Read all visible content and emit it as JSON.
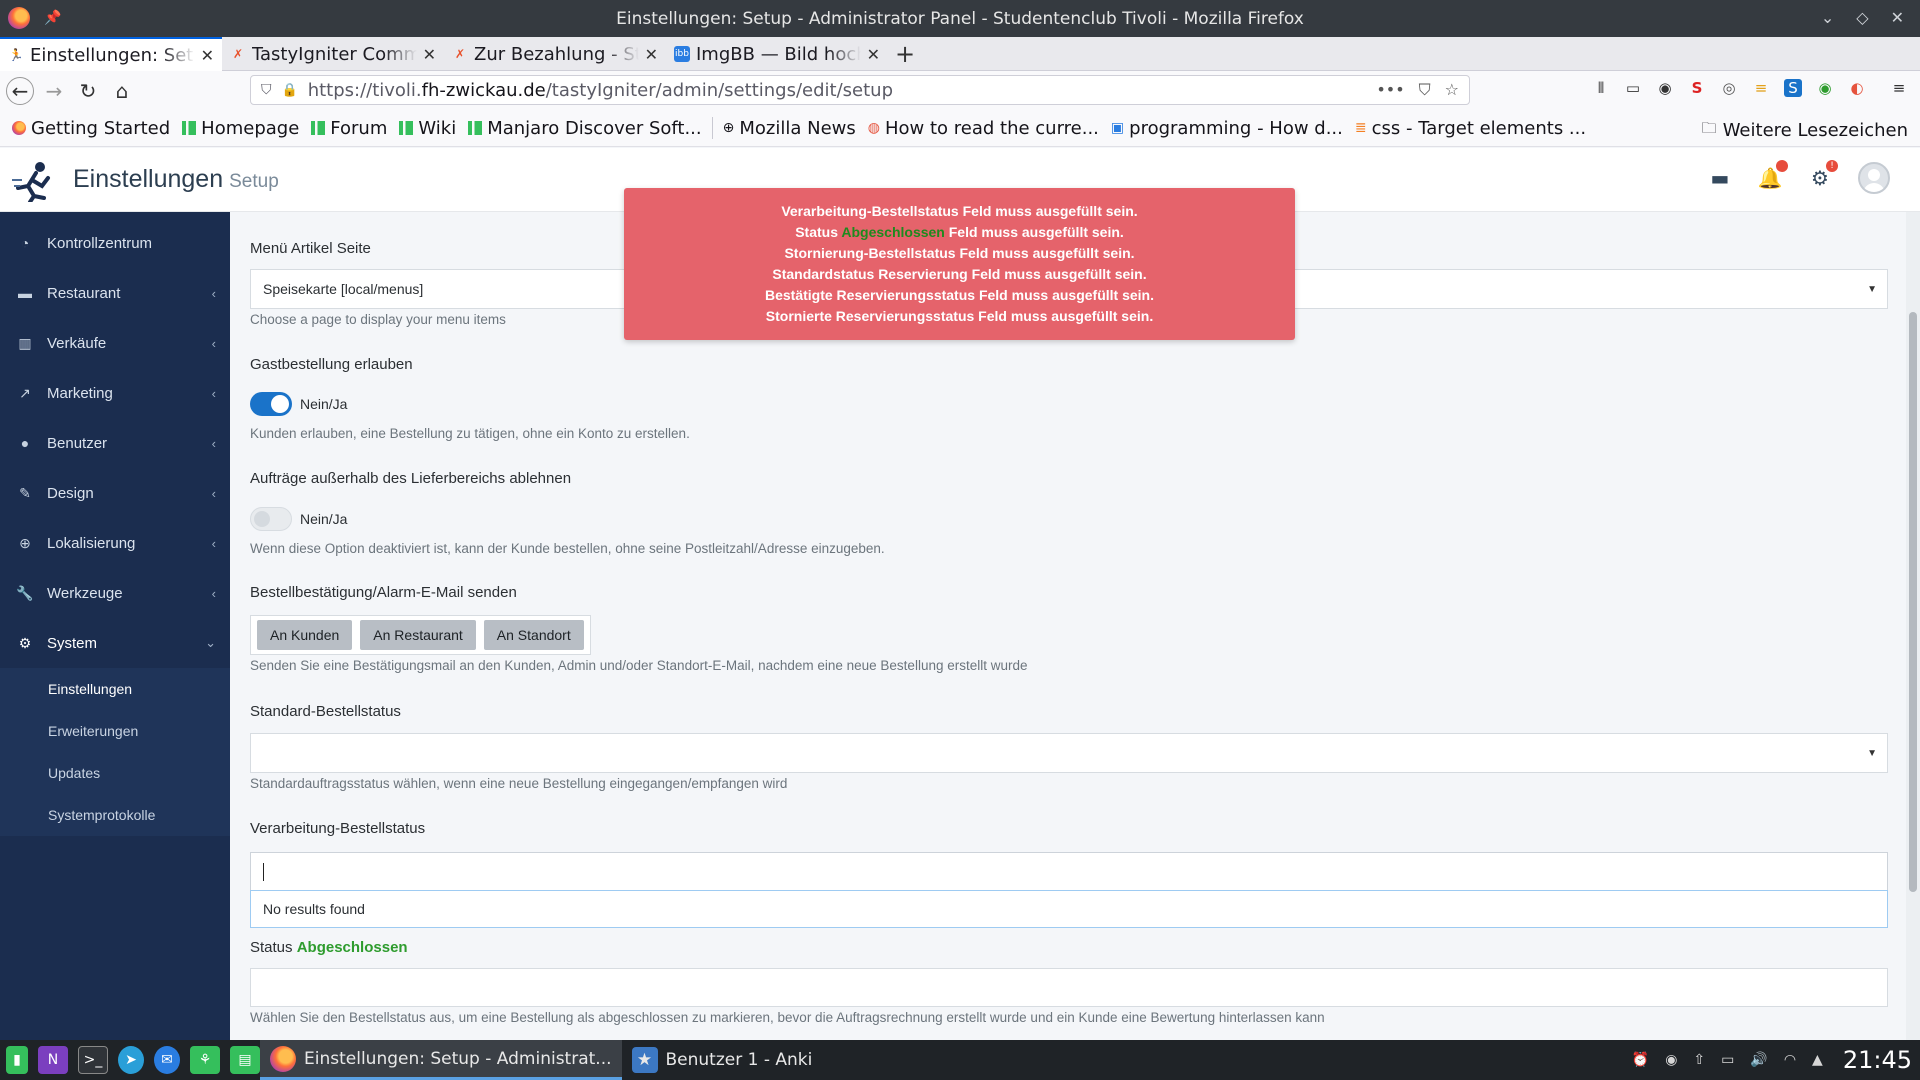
{
  "window": {
    "title": "Einstellungen: Setup - Administrator Panel - Studentenclub Tivoli - Mozilla Firefox"
  },
  "tabs": [
    {
      "label": "Einstellungen: Setup",
      "favicon": "runner-icon"
    },
    {
      "label": "TastyIgniter Community",
      "favicon": "tastyigniter-icon"
    },
    {
      "label": "Zur Bezahlung - Studentenclub",
      "favicon": "tastyigniter-icon"
    },
    {
      "label": "ImgBB — Bild hochladen",
      "favicon": "imgbb-icon"
    }
  ],
  "navbar": {
    "url_prefix": "https://tivoli.",
    "url_host": "fh-zwickau.de",
    "url_path": "/tastyIgniter/admin/settings/edit/setup"
  },
  "bookmarks": {
    "items": [
      {
        "label": "Getting Started"
      },
      {
        "label": "Homepage"
      },
      {
        "label": "Forum"
      },
      {
        "label": "Wiki"
      },
      {
        "label": "Manjaro Discover Soft..."
      },
      {
        "label": "Mozilla News"
      },
      {
        "label": "How to read the curre..."
      },
      {
        "label": "programming - How d..."
      },
      {
        "label": "css - Target elements ..."
      }
    ],
    "more": "Weitere Lesezeichen"
  },
  "header": {
    "title": "Einstellungen",
    "subtitle": "Setup",
    "notification_badge": "",
    "settings_badge": "!"
  },
  "sidebar": {
    "items": [
      {
        "label": "Kontrollzentrum",
        "icon": "dashboard-icon"
      },
      {
        "label": "Restaurant",
        "icon": "store-icon"
      },
      {
        "label": "Verkäufe",
        "icon": "bar-chart-icon"
      },
      {
        "label": "Marketing",
        "icon": "line-chart-icon"
      },
      {
        "label": "Benutzer",
        "icon": "user-icon"
      },
      {
        "label": "Design",
        "icon": "paint-brush-icon"
      },
      {
        "label": "Lokalisierung",
        "icon": "globe-icon"
      },
      {
        "label": "Werkzeuge",
        "icon": "wrench-icon"
      },
      {
        "label": "System",
        "icon": "cogs-icon"
      }
    ],
    "system_subitems": [
      {
        "label": "Einstellungen"
      },
      {
        "label": "Erweiterungen"
      },
      {
        "label": "Updates"
      },
      {
        "label": "Systemprotokolle"
      }
    ]
  },
  "form": {
    "menu_page": {
      "label": "Menü Artikel Seite",
      "value": "Speisekarte [local/menus]",
      "help": "Choose a page to display your menu items"
    },
    "guest_order": {
      "label": "Gastbestellung erlauben",
      "toggle_label": "Nein/Ja",
      "state": "on",
      "help": "Kunden erlauben, eine Bestellung zu tätigen, ohne ein Konto zu erstellen."
    },
    "reject_outside": {
      "label": "Aufträge außerhalb des Lieferbereichs ablehnen",
      "toggle_label": "Nein/Ja",
      "state": "off",
      "help": "Wenn diese Option deaktiviert ist, kann der Kunde bestellen, ohne seine Postleitzahl/Adresse einzugeben."
    },
    "order_email": {
      "label": "Bestellbestätigung/Alarm-E-Mail senden",
      "buttons": [
        "An Kunden",
        "An Restaurant",
        "An Standort"
      ],
      "help": "Senden Sie eine Bestätigungsmail an den Kunden, Admin und/oder Standort-E-Mail, nachdem eine neue Bestellung erstellt wurde"
    },
    "default_status": {
      "label": "Standard-Bestellstatus",
      "value": "",
      "help": "Standardauftragsstatus wählen, wenn eine neue Bestellung eingegangen/empfangen wird"
    },
    "processing_status": {
      "label": "Verarbeitung-Bestellstatus",
      "search_value": "",
      "no_results": "No results found"
    },
    "completed_status": {
      "label_prefix": "Status",
      "label_highlight": "Abgeschlossen",
      "help": "Wählen Sie den Bestellstatus aus, um eine Bestellung als abgeschlossen zu markieren, bevor die Auftragsrechnung erstellt wurde und ein Kunde eine Bewertung hinterlassen kann"
    }
  },
  "alert": {
    "lines": [
      "Verarbeitung-Bestellstatus Feld muss ausgefüllt sein.",
      "Stornierung-Bestellstatus Feld muss ausgefüllt sein.",
      "Standardstatus Reservierung Feld muss ausgefüllt sein.",
      "Bestätigte Reservierungsstatus Feld muss ausgefüllt sein.",
      "Stornierte Reservierungsstatus Feld muss ausgefüllt sein."
    ],
    "status_line": {
      "prefix": "Status",
      "highlight": "Abgeschlossen",
      "suffix": "Feld muss ausgefüllt sein."
    },
    "color": "#e5636b"
  },
  "taskbar": {
    "tasks": [
      {
        "label": "Einstellungen: Setup - Administrat...",
        "icon": "firefox-icon"
      },
      {
        "label": "Benutzer 1 - Anki",
        "icon": "anki-icon"
      }
    ],
    "clock": "21:45"
  },
  "colors": {
    "sidebar": "#1b2d4f",
    "accent": "#1a73c9",
    "success": "#2e9c2e"
  }
}
